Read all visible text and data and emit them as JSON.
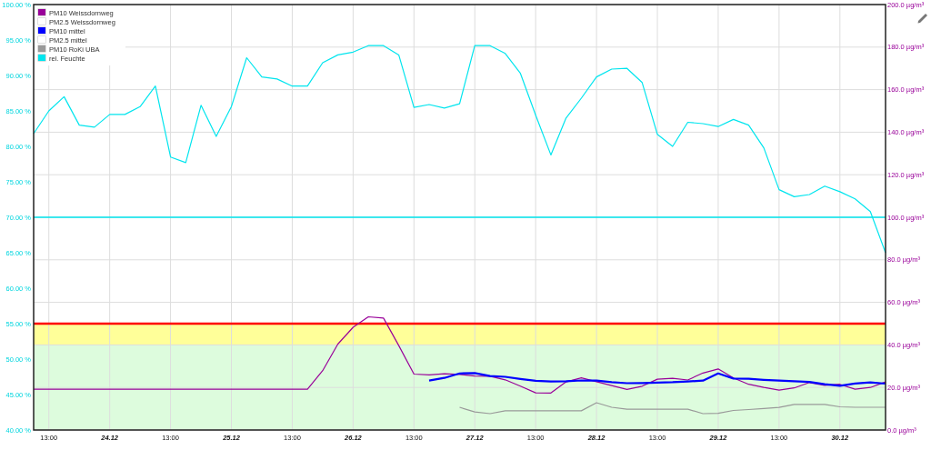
{
  "chart": {
    "chart_data": {
      "type": "line",
      "categories": [
        null,
        "13:00",
        null,
        null,
        null,
        "24.12",
        null,
        null,
        null,
        "13:00",
        null,
        null,
        null,
        "25.12",
        null,
        null,
        null,
        "13:00",
        null,
        null,
        null,
        "26.12",
        null,
        null,
        null,
        "13:00",
        null,
        null,
        null,
        "27.12",
        null,
        null,
        null,
        "13:00",
        null,
        null,
        null,
        "28.12",
        null,
        null,
        null,
        "13:00",
        null,
        null,
        null,
        "29.12",
        null,
        null,
        null,
        "13:00",
        null,
        null,
        null,
        "30.12",
        null,
        null,
        null
      ],
      "ylim": [
        40,
        100
      ],
      "y2lim": [
        0,
        200
      ],
      "yticks": [
        {
          "value": 40,
          "label": "40.00 %"
        },
        {
          "value": 45,
          "label": "45.00 %"
        },
        {
          "value": 50,
          "label": "50.00 %"
        },
        {
          "value": 55,
          "label": "55.00 %"
        },
        {
          "value": 60,
          "label": "60.00 %"
        },
        {
          "value": 65,
          "label": "65.00 %"
        },
        {
          "value": 70,
          "label": "70.00 %"
        },
        {
          "value": 75,
          "label": "75.00 %"
        },
        {
          "value": 80,
          "label": "80.00 %"
        },
        {
          "value": 85,
          "label": "85.00 %"
        },
        {
          "value": 90,
          "label": "90.00 %"
        },
        {
          "value": 95,
          "label": "95.00 %"
        },
        {
          "value": 100,
          "label": "100.00 %"
        }
      ],
      "y2ticks": [
        {
          "value": 0,
          "label": "0.0 µg/m³"
        },
        {
          "value": 20,
          "label": "20.0 µg/m³"
        },
        {
          "value": 40,
          "label": "40.0 µg/m³"
        },
        {
          "value": 60,
          "label": "60.0 µg/m³"
        },
        {
          "value": 80,
          "label": "80.0 µg/m³"
        },
        {
          "value": 100,
          "label": "100.0 µg/m³"
        },
        {
          "value": 120,
          "label": "120.0 µg/m³"
        },
        {
          "value": 140,
          "label": "140.0 µg/m³"
        },
        {
          "value": 160,
          "label": "160.0 µg/m³"
        },
        {
          "value": 180,
          "label": "180.0 µg/m³"
        },
        {
          "value": 200,
          "label": "200.0 µg/m³"
        }
      ],
      "bands": [
        {
          "axis": "y2",
          "from": 0,
          "to": 40,
          "color": "#ddfcdd"
        },
        {
          "axis": "y2",
          "from": 40,
          "to": 50,
          "color": "#ffff99"
        }
      ],
      "ref_lines": [
        {
          "axis": "y2",
          "value": 50,
          "color": "#ff0000"
        },
        {
          "axis": "y",
          "value": 70,
          "color": "#00e5ee"
        }
      ],
      "grid": true,
      "legend": true,
      "series": [
        {
          "name": "PM10 Weissdornweg",
          "color": "#990099",
          "axis": "y2",
          "values": [
            19.2,
            19.2,
            19.2,
            19.2,
            19.2,
            19.2,
            19.2,
            19.2,
            19.2,
            19.2,
            19.2,
            19.2,
            19.2,
            19.2,
            19.2,
            19.2,
            19.2,
            19.2,
            19.2,
            27.9,
            40.4,
            48.3,
            53.2,
            52.6,
            39.7,
            26.3,
            25.9,
            26.4,
            26.1,
            25.4,
            25.3,
            23.6,
            20.6,
            17.5,
            17.4,
            22.6,
            24.5,
            22.7,
            20.9,
            19.1,
            20.6,
            23.9,
            24.3,
            23.5,
            26.8,
            28.7,
            24.5,
            21.5,
            20.0,
            18.7,
            19.8,
            22.3,
            21.0,
            21.5,
            19.2,
            20.0,
            22.6
          ]
        },
        {
          "name": "PM2.5 Weissdornweg",
          "color": "#ffffff",
          "values": [
            null,
            null,
            null,
            null,
            null,
            null,
            null,
            null,
            null,
            null,
            null,
            null,
            null,
            null,
            null,
            null,
            null,
            null,
            null,
            null,
            null,
            null,
            null,
            null,
            null,
            null,
            null,
            null,
            null,
            null,
            null,
            null,
            null,
            null,
            null,
            null,
            null,
            null,
            null,
            null,
            null,
            null,
            null,
            null,
            null,
            null,
            null,
            null,
            null,
            null,
            null,
            null,
            null,
            null,
            null,
            null,
            null
          ]
        },
        {
          "name": "PM10 mittel",
          "color": "#0000ff",
          "axis": "y2",
          "values": [
            null,
            null,
            null,
            null,
            null,
            null,
            null,
            null,
            null,
            null,
            null,
            null,
            null,
            null,
            null,
            null,
            null,
            null,
            null,
            null,
            null,
            null,
            null,
            null,
            null,
            null,
            23.2,
            24.5,
            26.6,
            26.8,
            25.4,
            25.0,
            24.0,
            23.1,
            22.8,
            22.9,
            23.3,
            23.2,
            22.5,
            22.0,
            22.1,
            22.3,
            22.5,
            22.8,
            23.2,
            26.6,
            24.2,
            24.1,
            23.6,
            23.2,
            22.9,
            22.6,
            21.5,
            20.8,
            21.9,
            22.4,
            21.8
          ]
        },
        {
          "name": "PM2.5 mittel",
          "color": "#ffffff",
          "values": [
            null,
            null,
            null,
            null,
            null,
            null,
            null,
            null,
            null,
            null,
            null,
            null,
            null,
            null,
            null,
            null,
            null,
            null,
            null,
            null,
            null,
            null,
            null,
            null,
            null,
            null,
            null,
            null,
            null,
            null,
            null,
            null,
            null,
            null,
            null,
            null,
            null,
            null,
            null,
            null,
            null,
            null,
            null,
            null,
            null,
            null,
            null,
            null,
            null,
            null,
            null,
            null,
            null,
            null,
            null,
            null,
            null
          ]
        },
        {
          "name": "PM10 RoKi UBA",
          "color": "#999999",
          "axis": "y2",
          "values": [
            null,
            null,
            null,
            null,
            null,
            null,
            null,
            null,
            null,
            null,
            null,
            null,
            null,
            null,
            null,
            null,
            null,
            null,
            null,
            null,
            null,
            null,
            null,
            null,
            null,
            null,
            null,
            null,
            10.7,
            8.5,
            7.7,
            9.0,
            9.0,
            9.0,
            9.0,
            9.0,
            9.0,
            12.8,
            10.7,
            9.8,
            9.8,
            9.8,
            9.8,
            9.8,
            7.7,
            7.8,
            9.2,
            9.6,
            10.1,
            10.6,
            12.0,
            12.0,
            12.0,
            10.9,
            10.7,
            10.7,
            10.7
          ]
        },
        {
          "name": "rel. Feuchte",
          "color": "#00e5ee",
          "values": [
            81.8,
            85.0,
            87.0,
            83.0,
            82.7,
            84.5,
            84.5,
            85.6,
            88.5,
            78.5,
            77.7,
            85.8,
            81.4,
            85.6,
            92.5,
            89.8,
            89.5,
            88.5,
            88.5,
            91.8,
            92.9,
            93.3,
            94.2,
            94.2,
            92.9,
            85.5,
            85.9,
            85.4,
            86.0,
            94.2,
            94.2,
            93.1,
            90.3,
            84.4,
            78.8,
            84.0,
            86.8,
            89.8,
            90.9,
            91.0,
            89.0,
            81.7,
            80.0,
            83.4,
            83.2,
            82.8,
            83.8,
            83.0,
            79.8,
            73.9,
            72.9,
            73.2,
            74.4,
            73.6,
            72.6,
            70.8,
            65.0
          ]
        }
      ]
    }
  }
}
